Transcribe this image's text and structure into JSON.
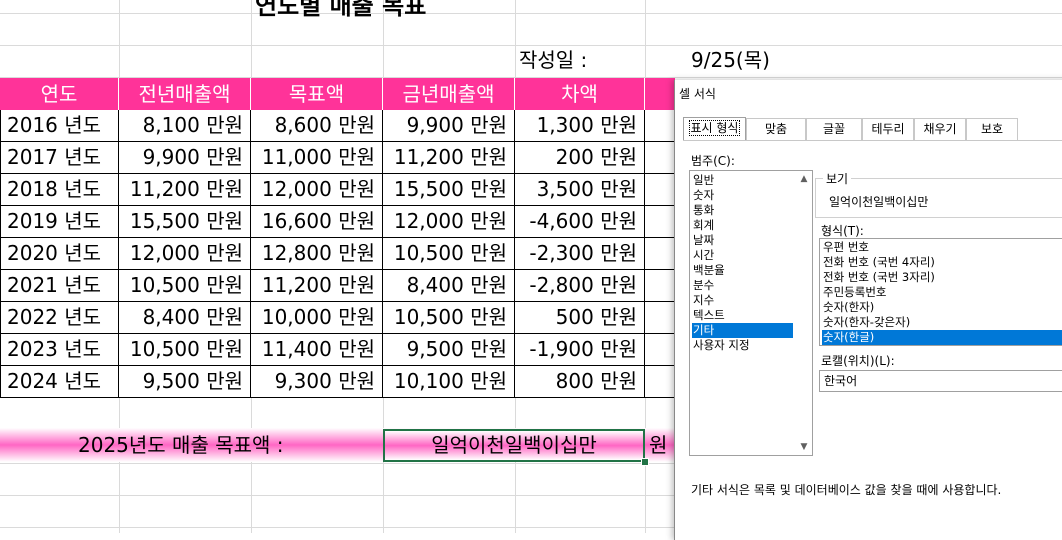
{
  "sheet": {
    "title_fragment": "연도별 매출 목표",
    "date_label": "작성일 :",
    "date_value": "9/25(목)",
    "headers": [
      "연도",
      "전년매출액",
      "목표액",
      "금년매출액",
      "차액"
    ],
    "rows": [
      [
        "2016 년도",
        "8,100 만원",
        "8,600 만원",
        "9,900 만원",
        "1,300 만원"
      ],
      [
        "2017 년도",
        "9,900 만원",
        "11,000 만원",
        "11,200 만원",
        "200 만원"
      ],
      [
        "2018 년도",
        "11,200 만원",
        "12,000 만원",
        "15,500 만원",
        "3,500 만원"
      ],
      [
        "2019 년도",
        "15,500 만원",
        "16,600 만원",
        "12,000 만원",
        "-4,600 만원"
      ],
      [
        "2020 년도",
        "12,000 만원",
        "12,800 만원",
        "10,500 만원",
        "-2,300 만원"
      ],
      [
        "2021 년도",
        "10,500 만원",
        "11,200 만원",
        "8,400 만원",
        "-2,800 만원"
      ],
      [
        "2022 년도",
        "8,400 만원",
        "10,000 만원",
        "10,500 만원",
        "500 만원"
      ],
      [
        "2023 년도",
        "10,500 만원",
        "11,400 만원",
        "9,500 만원",
        "-1,900 만원"
      ],
      [
        "2024 년도",
        "9,500 만원",
        "9,300 만원",
        "10,100 만원",
        "800 만원"
      ]
    ],
    "target_label": "2025년도 매출 목표액 :",
    "target_value": "일억이천일백이십만",
    "target_suffix_fragment": "원",
    "colors": {
      "header_bg": "#ff3399",
      "band_mid": "#ff66c4",
      "selection": "#217346"
    }
  },
  "dialog": {
    "title": "셀 서식",
    "tabs": [
      "표시 형식",
      "맞춤",
      "글꼴",
      "테두리",
      "채우기",
      "보호"
    ],
    "category_label": "범주(C):",
    "categories": [
      "일반",
      "숫자",
      "통화",
      "회계",
      "날짜",
      "시간",
      "백분율",
      "분수",
      "지수",
      "텍스트",
      "기타",
      "사용자 지정"
    ],
    "selected_category": "기타",
    "preview_label": "보기",
    "preview_value": "일억이천일백이십만",
    "type_label": "형식(T):",
    "types": [
      "우편 번호",
      "전화 번호 (국번 4자리)",
      "전화 번호 (국번 3자리)",
      "주민등록번호",
      "숫자(한자)",
      "숫자(한자-갖은자)",
      "숫자(한글)"
    ],
    "selected_type": "숫자(한글)",
    "locale_label": "로캘(위치)(L):",
    "locale_value": "한국어",
    "description": "기타 서식은 목록 및 데이터베이스 값을 찾을 때에 사용합니다.",
    "colors": {
      "selection": "#0078d7"
    }
  }
}
